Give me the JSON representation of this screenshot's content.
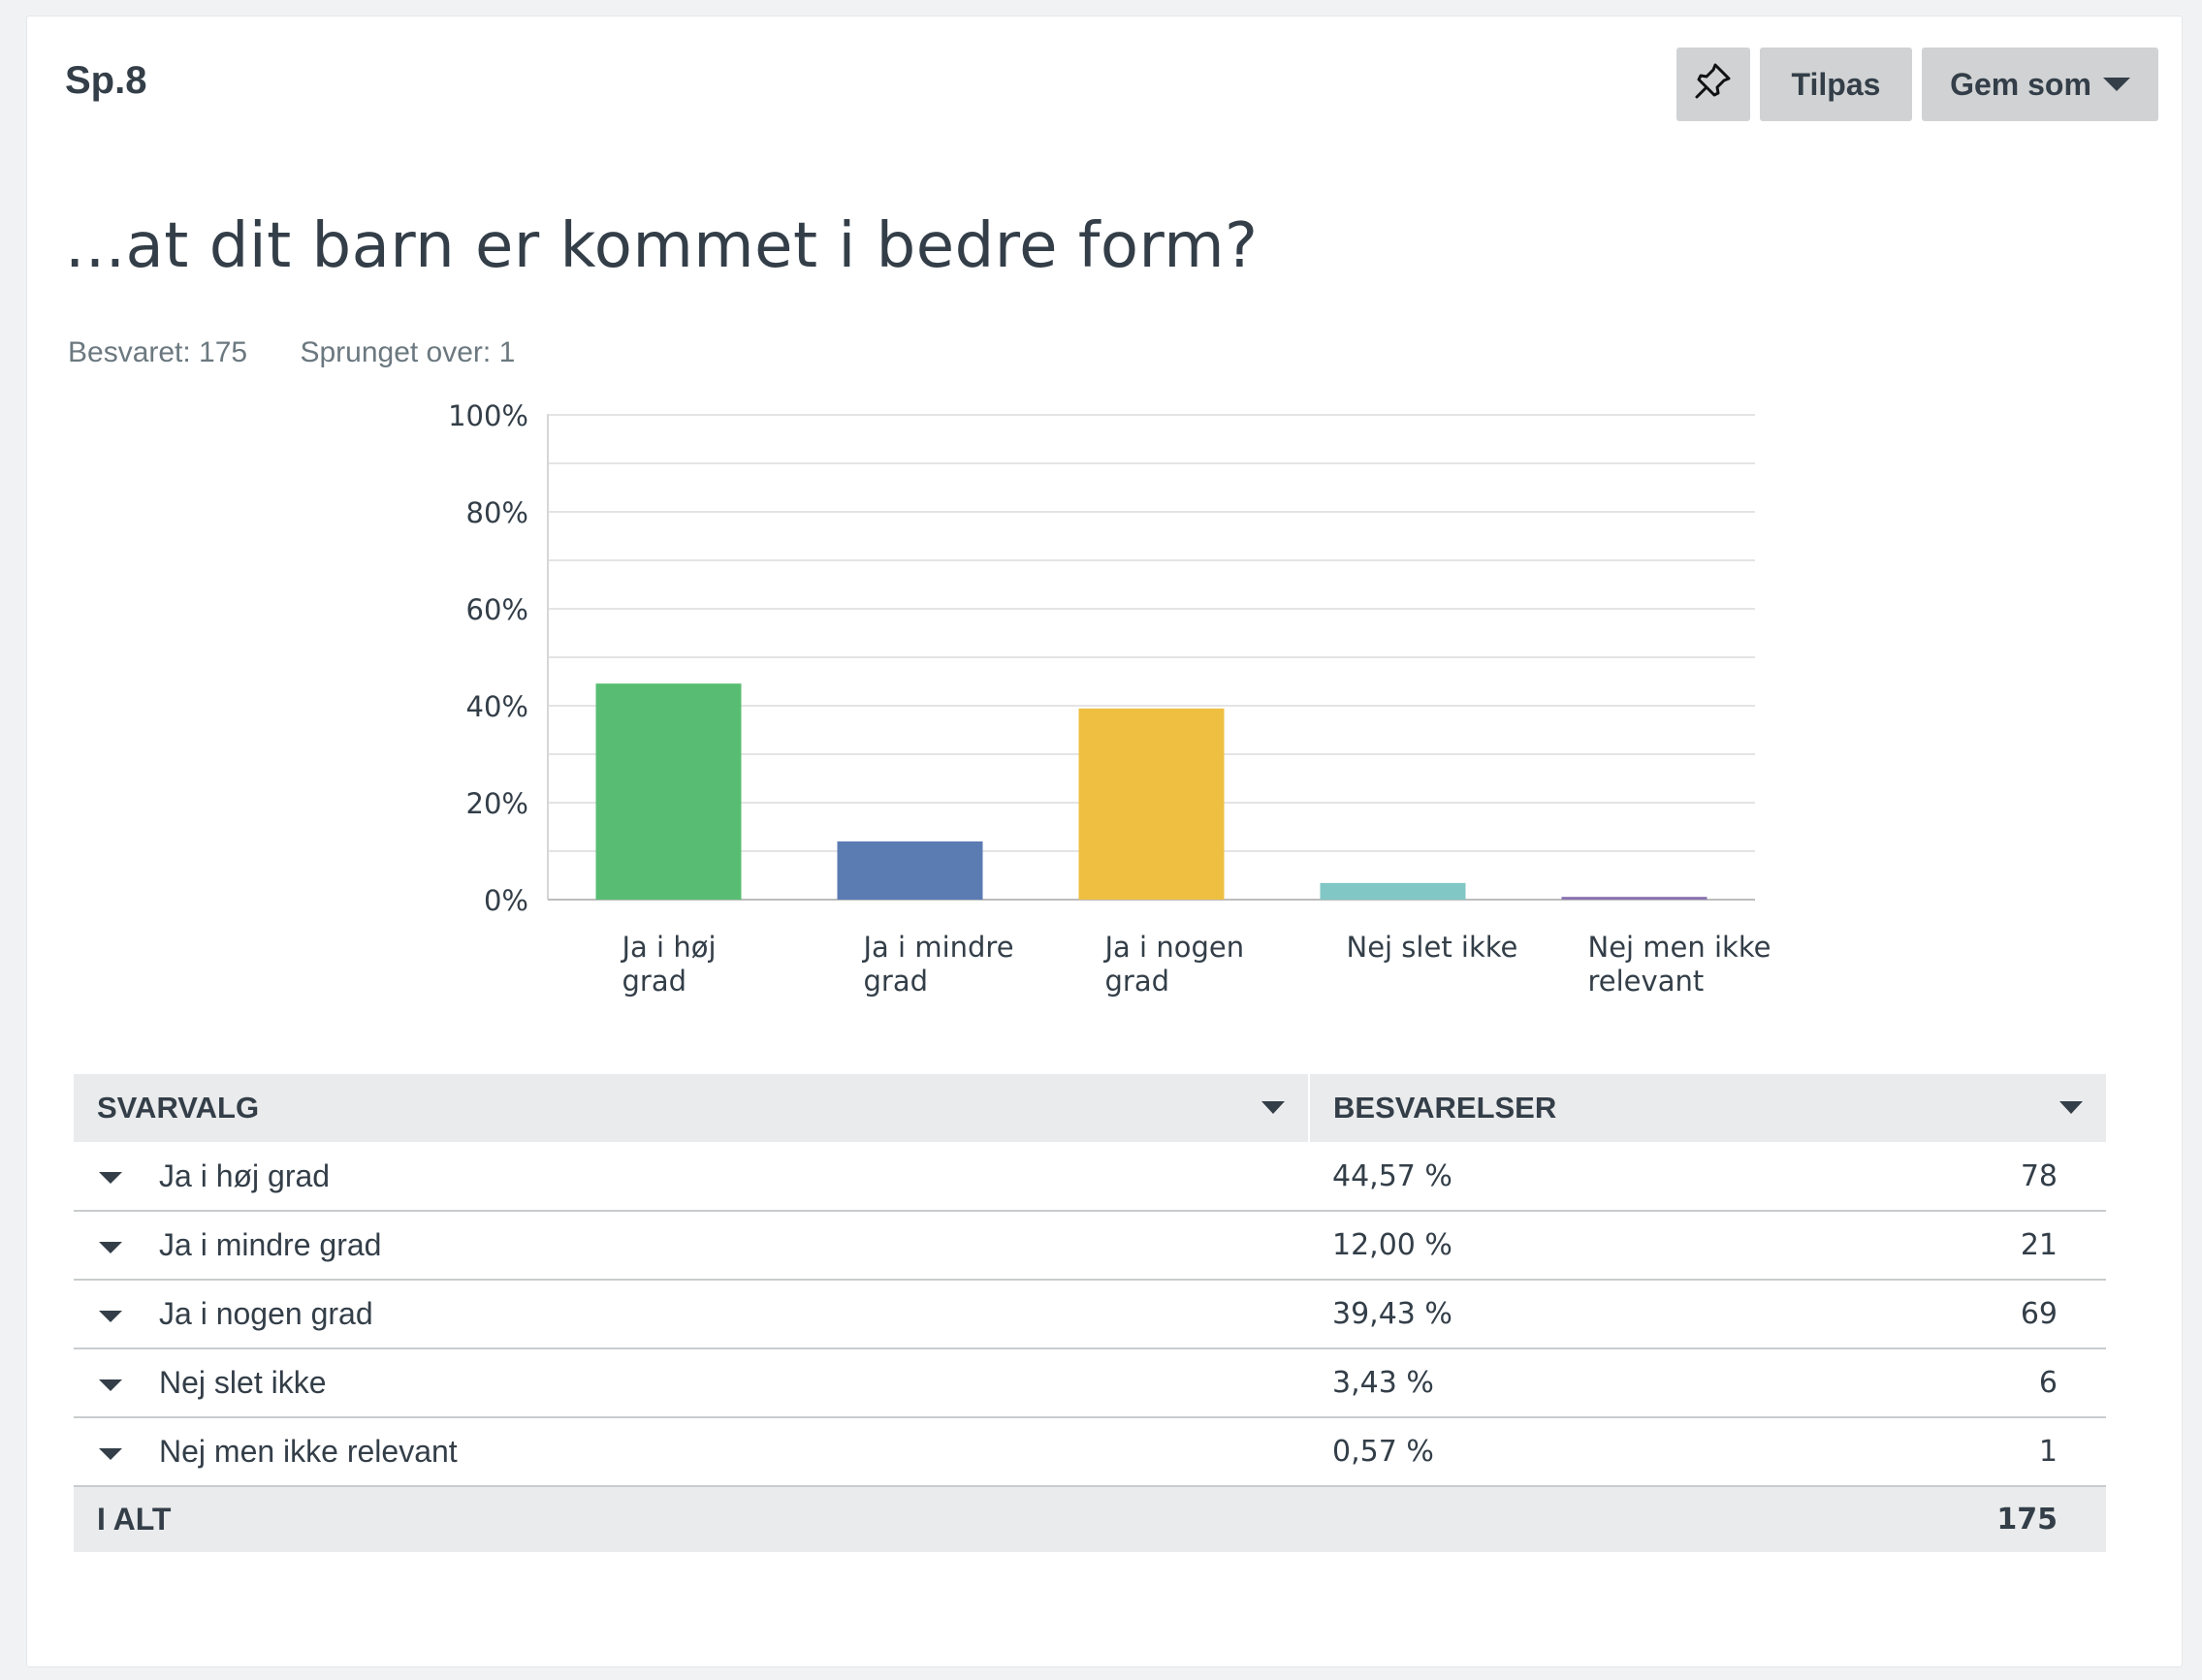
{
  "question": {
    "number": "Sp.8",
    "title": "...at dit barn er kommet i bedre form?",
    "answered": "Besvaret: 175",
    "skipped": "Sprunget over: 1"
  },
  "toolbar": {
    "pin_icon": "pin-icon",
    "customize_label": "Tilpas",
    "save_as_label": "Gem som"
  },
  "colors": {
    "green": "#58bd72",
    "blue": "#5b7bb3",
    "yellow": "#eebf40",
    "teal": "#80c7c5",
    "purple": "#8a73b0"
  },
  "chart_data": {
    "type": "bar",
    "categories": [
      [
        "Ja i høj",
        "grad"
      ],
      [
        "Ja i mindre",
        "grad"
      ],
      [
        "Ja i nogen",
        "grad"
      ],
      [
        "Nej slet ikke"
      ],
      [
        "Nej men ikke",
        "relevant"
      ]
    ],
    "values": [
      44.57,
      12.0,
      39.43,
      3.43,
      0.57
    ],
    "ylim": [
      0,
      100
    ],
    "yticks": [
      "0%",
      "20%",
      "40%",
      "60%",
      "80%",
      "100%"
    ],
    "grid": true,
    "bar_colors": [
      "#58bd72",
      "#5b7bb3",
      "#eebf40",
      "#80c7c5",
      "#8a73b0"
    ]
  },
  "table": {
    "headers": [
      "SVARVALG",
      "BESVARELSER"
    ],
    "rows": [
      {
        "label": "Ja i høj grad",
        "percent": "44,57 %",
        "count": "78"
      },
      {
        "label": "Ja i mindre grad",
        "percent": "12,00 %",
        "count": "21"
      },
      {
        "label": "Ja i nogen grad",
        "percent": "39,43 %",
        "count": "69"
      },
      {
        "label": "Nej slet ikke",
        "percent": "3,43 %",
        "count": "6"
      },
      {
        "label": "Nej men ikke relevant",
        "percent": "0,57 %",
        "count": "1"
      }
    ],
    "total_label": "I ALT",
    "total_count": "175"
  }
}
